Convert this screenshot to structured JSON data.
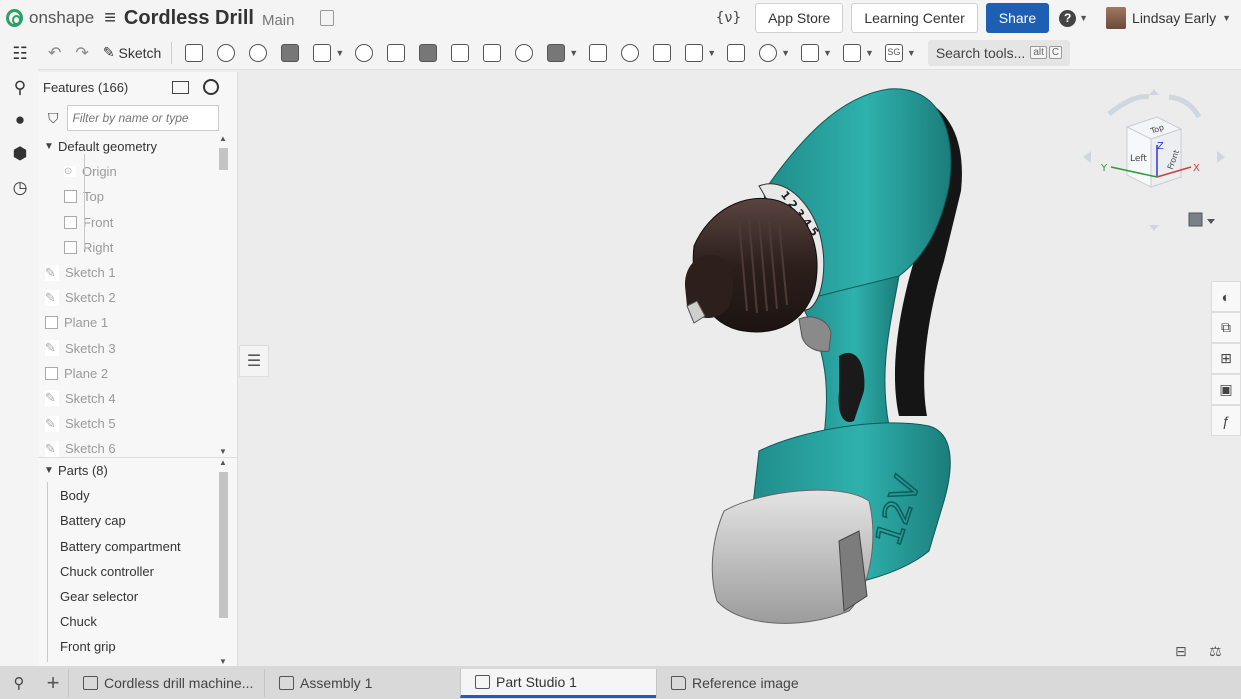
{
  "app": {
    "brand": "onshape",
    "doc_title": "Cordless Drill",
    "branch": "Main"
  },
  "header": {
    "variables_glyph": "{ν}",
    "app_store": "App Store",
    "learning_center": "Learning Center",
    "share": "Share",
    "help_glyph": "?",
    "user_name": "Lindsay Early"
  },
  "toolbar": {
    "sketch_label": "Sketch",
    "search_placeholder": "Search tools...",
    "search_shortcut_1": "alt",
    "search_shortcut_2": "C",
    "sg_label": "SG"
  },
  "features": {
    "title": "Features (166)",
    "filter_placeholder": "Filter by name or type",
    "default_geometry": "Default geometry",
    "items": [
      {
        "label": "Origin",
        "icon": "origin-icon"
      },
      {
        "label": "Top",
        "icon": "plane-icon"
      },
      {
        "label": "Front",
        "icon": "plane-icon"
      },
      {
        "label": "Right",
        "icon": "plane-icon"
      },
      {
        "label": "Sketch 1",
        "icon": "sketch-icon"
      },
      {
        "label": "Sketch 2",
        "icon": "sketch-icon"
      },
      {
        "label": "Plane 1",
        "icon": "plane-icon"
      },
      {
        "label": "Sketch 3",
        "icon": "sketch-icon"
      },
      {
        "label": "Plane 2",
        "icon": "plane-icon"
      },
      {
        "label": "Sketch 4",
        "icon": "sketch-icon"
      },
      {
        "label": "Sketch 5",
        "icon": "sketch-icon"
      },
      {
        "label": "Sketch 6",
        "icon": "sketch-icon"
      }
    ]
  },
  "parts": {
    "title": "Parts (8)",
    "items": [
      "Body",
      "Battery cap",
      "Battery compartment",
      "Chuck controller",
      "Gear selector",
      "Chuck",
      "Front grip"
    ]
  },
  "viewcube": {
    "top": "Top",
    "left": "Left",
    "front": "Front",
    "axis_x": "X",
    "axis_y": "Y",
    "axis_z": "Z"
  },
  "model": {
    "battery_label": "12V",
    "gear_numbers": "1 2 3 4 5"
  },
  "tabs": [
    {
      "label": "Cordless drill machine...",
      "icon": "image-icon"
    },
    {
      "label": "Assembly 1",
      "icon": "assembly-icon"
    },
    {
      "label": "Part Studio 1",
      "icon": "part-studio-icon",
      "active": true
    },
    {
      "label": "Reference image",
      "icon": "folder-icon"
    }
  ],
  "colors": {
    "accent": "#1f5fb3",
    "drill_body": "#29a3a0",
    "chuck": "#3a2a26",
    "battery": "#c4c4c4"
  }
}
